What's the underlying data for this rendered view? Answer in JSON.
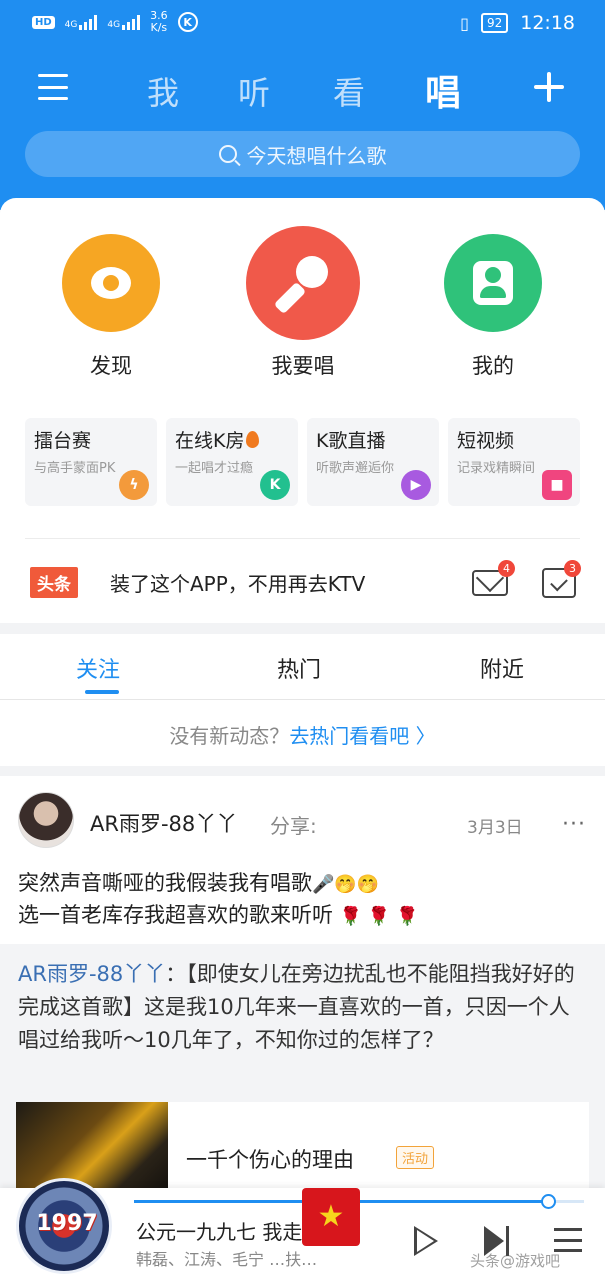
{
  "statusbar": {
    "hd": "HD",
    "network_a": "4G",
    "network_b": "4G",
    "speed_value": "3.6",
    "speed_unit": "K/s",
    "k_icon": "K",
    "battery": "92",
    "time": "12:18"
  },
  "nav": {
    "tabs": [
      "我",
      "听",
      "看",
      "唱"
    ],
    "active_tab": "唱",
    "search_placeholder": "今天想唱什么歌"
  },
  "features": [
    {
      "label": "发现",
      "icon": "eye-icon",
      "color": "#f6a623"
    },
    {
      "label": "我要唱",
      "icon": "microphone-icon",
      "color": "#f0594a"
    },
    {
      "label": "我的",
      "icon": "user-icon",
      "color": "#2fc27a"
    }
  ],
  "tiles": [
    {
      "title": "擂台赛",
      "subtitle": "与高手蒙面PK",
      "icon": "lightning-icon",
      "icon_color": "#f39a3b"
    },
    {
      "title": "在线K房",
      "subtitle": "一起唱才过瘾",
      "icon": "k-room-icon",
      "icon_color": "#22c08f"
    },
    {
      "title": "K歌直播",
      "subtitle": "听歌声邂逅你",
      "icon": "live-icon",
      "icon_color": "#a85ae0"
    },
    {
      "title": "短视频",
      "subtitle": "记录戏精瞬间",
      "icon": "video-camera-icon",
      "icon_color": "#f0457f"
    }
  ],
  "headline": {
    "badge": "头条",
    "text": "装了这个APP，不用再去KTV",
    "mail_badge": "4",
    "task_badge": "3"
  },
  "feed_tabs": [
    "关注",
    "热门",
    "附近"
  ],
  "active_feed_tab": "关注",
  "no_new": {
    "text": "没有新动态？",
    "link": "去热门看看吧 〉"
  },
  "post": {
    "username": "AR雨罗-88丫丫",
    "action": "分享:",
    "date": "3月3日",
    "line1": "突然声音嘶哑的我假装我有唱歌",
    "line1_emoji": "🎤🤭🤭",
    "line2": "选一首老库存我超喜欢的歌来听听",
    "line2_emoji": "🌹 🌹 🌹",
    "quote_name": "AR雨罗-88丫丫",
    "quote_text": "：【即使女儿在旁边扰乱也不能阻挡我好好的完成这首歌】这是我10几年来一直喜欢的一首，只因一个人唱过给我听～10几年了，不知你过的怎样了？",
    "song_title": "一千个伤心的理由",
    "song_tag": "活动"
  },
  "player": {
    "cover_text": "1997",
    "title": "公元一九九七",
    "title_tail": "我走过你",
    "artists": "韩磊、江涛、毛宁",
    "artists_tail": "…扶…",
    "progress": 0.92
  },
  "watermark": "头条@游戏吧"
}
